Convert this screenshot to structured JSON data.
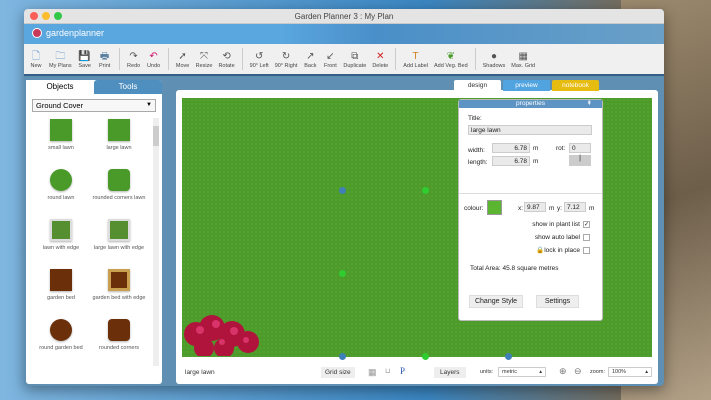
{
  "window": {
    "title": "Garden Planner 3 : My  Plan"
  },
  "brand": {
    "logo_text": "gardenplanner"
  },
  "toolbar": [
    {
      "label": "New",
      "icon": "new-file-icon",
      "glyph": "🗋"
    },
    {
      "label": "My Plans",
      "icon": "folder-icon",
      "glyph": "🗀"
    },
    {
      "label": "Save",
      "icon": "save-icon",
      "glyph": "💾"
    },
    {
      "label": "Print",
      "icon": "print-icon",
      "glyph": "🖶"
    },
    {
      "sep": true
    },
    {
      "label": "Redo",
      "icon": "redo-icon",
      "glyph": "↷"
    },
    {
      "label": "Undo",
      "icon": "undo-icon",
      "glyph": "↶"
    },
    {
      "sep": true
    },
    {
      "label": "Move",
      "icon": "cursor-icon",
      "glyph": "➚"
    },
    {
      "label": "Resize",
      "icon": "resize-icon",
      "glyph": "⤧"
    },
    {
      "label": "Rotate",
      "icon": "rotate-icon",
      "glyph": "⟲"
    },
    {
      "sep": true
    },
    {
      "label": "90° Left",
      "icon": "rotate-left-icon",
      "glyph": "↺"
    },
    {
      "label": "90° Right",
      "icon": "rotate-right-icon",
      "glyph": "↻"
    },
    {
      "label": "Back",
      "icon": "send-back-icon",
      "glyph": "↗"
    },
    {
      "label": "Front",
      "icon": "bring-front-icon",
      "glyph": "↙"
    },
    {
      "label": "Duplicate",
      "icon": "duplicate-icon",
      "glyph": "⧉"
    },
    {
      "label": "Delete",
      "icon": "delete-icon",
      "glyph": "✕"
    },
    {
      "sep": true
    },
    {
      "label": "Add Label",
      "icon": "text-icon",
      "glyph": "T"
    },
    {
      "label": "Add Veg. Bed",
      "icon": "veg-bed-icon",
      "glyph": "❦"
    },
    {
      "sep": true
    },
    {
      "label": "Shadows",
      "icon": "shadows-icon",
      "glyph": "●"
    },
    {
      "label": "Max. Grid",
      "icon": "grid-icon",
      "glyph": "▦"
    }
  ],
  "left_panel": {
    "tabs": [
      "Objects",
      "Tools"
    ],
    "category": "Ground Cover",
    "items": [
      {
        "label": "small lawn",
        "color": "#4a9a2a",
        "shape": "square"
      },
      {
        "label": "large lawn",
        "color": "#4a9a2a",
        "shape": "square"
      },
      {
        "label": "round lawn",
        "color": "#4a9a2a",
        "shape": "circle"
      },
      {
        "label": "rounded corners lawn",
        "color": "#4a9a2a",
        "shape": "rounded"
      },
      {
        "label": "lawn with edge",
        "color": "#558f30",
        "shape": "edge"
      },
      {
        "label": "large lawn with edge",
        "color": "#558f30",
        "shape": "edge"
      },
      {
        "label": "garden bed",
        "color": "#6b2f0a",
        "shape": "square"
      },
      {
        "label": "garden bed with edge",
        "color": "#6b2f0a",
        "shape": "bededge"
      },
      {
        "label": "round garden bed",
        "color": "#6b2f0a",
        "shape": "circle"
      },
      {
        "label": "rounded corners",
        "color": "#6b2f0a",
        "shape": "rounded"
      }
    ]
  },
  "view_tabs": [
    {
      "label": "design",
      "color": "#ffffff"
    },
    {
      "label": "preview",
      "color": "#52a4e0"
    },
    {
      "label": "notebook",
      "color": "#e6bc10"
    }
  ],
  "properties": {
    "header": "properties",
    "title_label": "Title:",
    "title_value": "large lawn",
    "width_label": "width:",
    "width_value": "6.78",
    "length_label": "length:",
    "length_value": "6.78",
    "unit": "m",
    "rot_label": "rot:",
    "rot_value": "0",
    "colour_label": "colour:",
    "colour": "#5cb531",
    "x_label": "x:",
    "x_value": "9.87",
    "y_label": "y:",
    "y_value": "7.12",
    "show_in_plant_list": {
      "label": "show in plant list",
      "checked": true
    },
    "show_auto_label": {
      "label": "show auto label",
      "checked": false
    },
    "lock_in_place": {
      "label": "lock in place",
      "checked": false
    },
    "total_area": "Total Area: 45.8 square metres",
    "change_style": "Change Style",
    "settings": "Settings"
  },
  "status": {
    "selected": "large lawn",
    "grid_size": "Grid size",
    "layers": "Layers",
    "units_label": "units:",
    "units_value": "metric",
    "zoom_label": "zoom:",
    "zoom_value": "100%"
  }
}
